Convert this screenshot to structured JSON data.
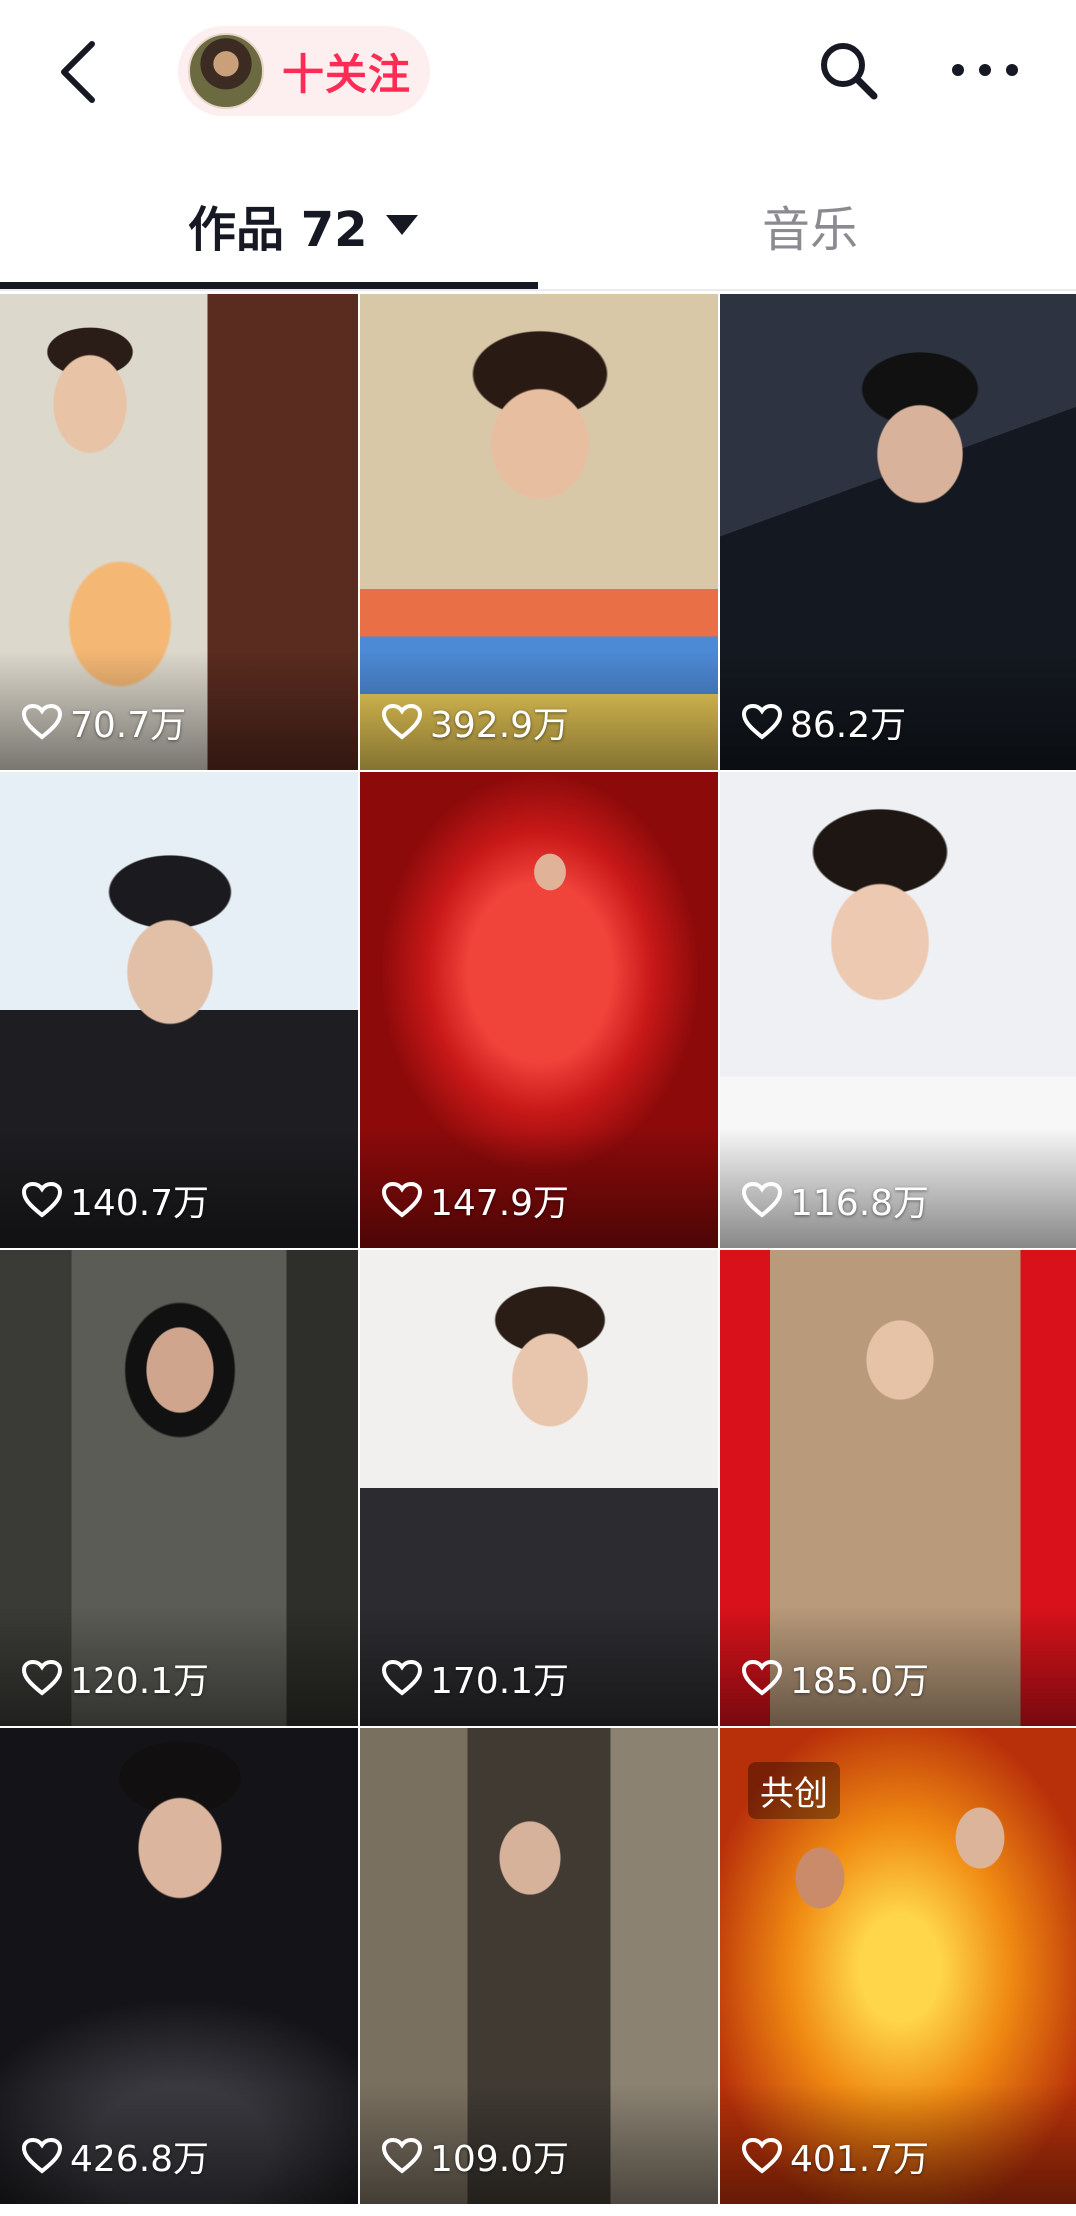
{
  "header": {
    "follow_label": "十关注",
    "icons": {
      "back": "back-chevron-icon",
      "search": "search-icon",
      "more": "more-dots-icon"
    }
  },
  "tabs": [
    {
      "label": "作品 72",
      "active": true
    },
    {
      "label": "音乐",
      "active": false
    }
  ],
  "colors": {
    "accent": "#fe2c55",
    "text": "#161823",
    "muted": "#8a8b91"
  },
  "videos": [
    {
      "likes": "70.7万"
    },
    {
      "likes": "392.9万"
    },
    {
      "likes": "86.2万"
    },
    {
      "likes": "140.7万"
    },
    {
      "likes": "147.9万"
    },
    {
      "likes": "116.8万"
    },
    {
      "likes": "120.1万"
    },
    {
      "likes": "170.1万"
    },
    {
      "likes": "185.0万"
    },
    {
      "likes": "426.8万"
    },
    {
      "likes": "109.0万"
    },
    {
      "likes": "401.7万",
      "badge": "共创"
    }
  ]
}
